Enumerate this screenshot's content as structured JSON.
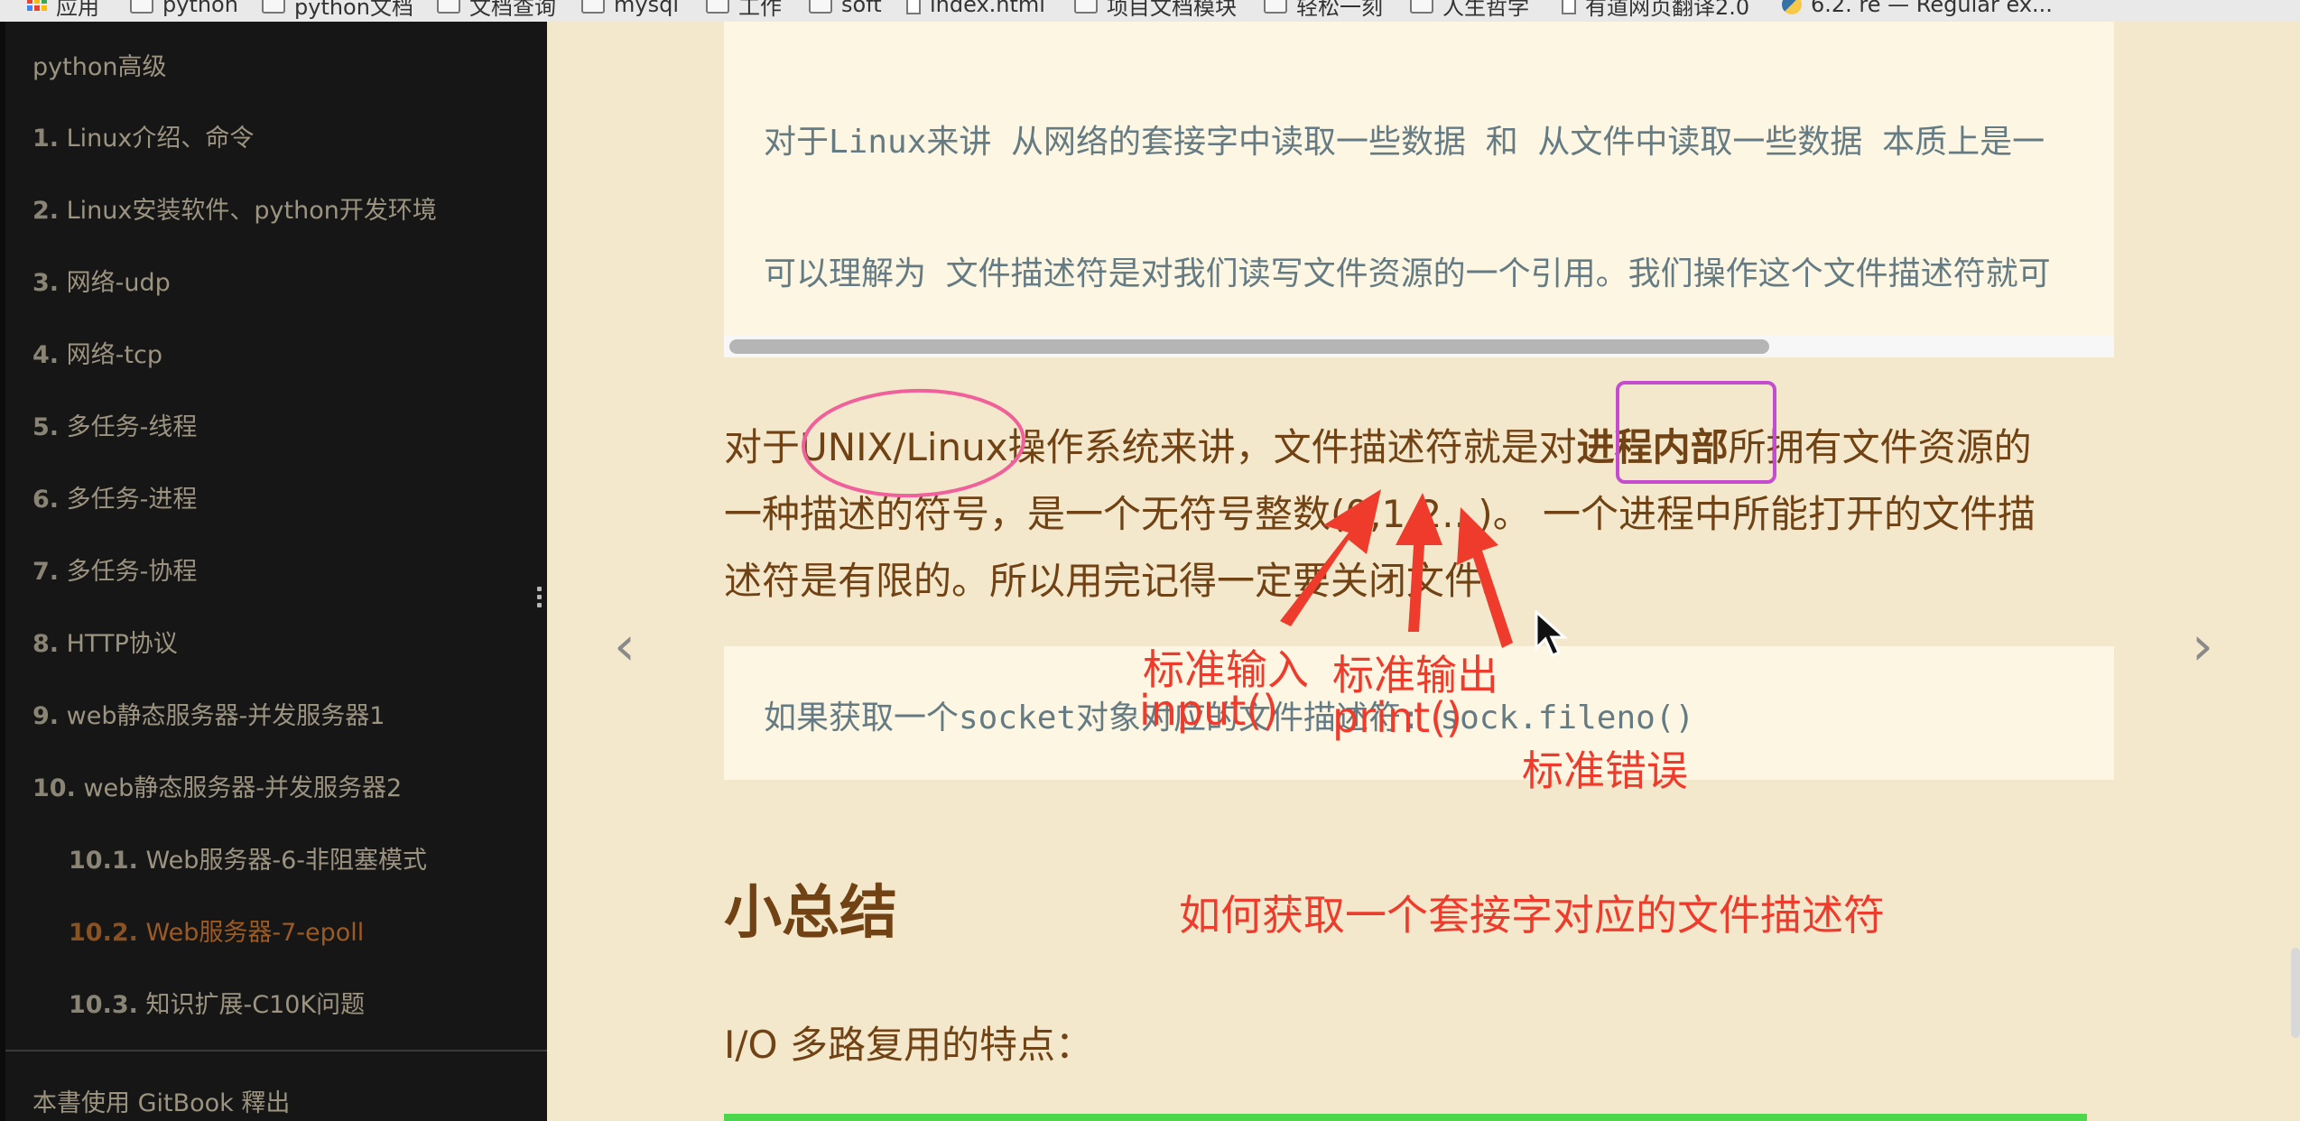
{
  "bookmarks": [
    {
      "label": "应用",
      "icon": "apps-grid-icon"
    },
    {
      "label": "python",
      "icon": "folder-icon"
    },
    {
      "label": "python文档",
      "icon": "folder-icon"
    },
    {
      "label": "文档查询",
      "icon": "folder-icon"
    },
    {
      "label": "mysql",
      "icon": "folder-icon"
    },
    {
      "label": "工作",
      "icon": "folder-icon"
    },
    {
      "label": "soft",
      "icon": "folder-icon"
    },
    {
      "label": "index.html",
      "icon": "page-icon"
    },
    {
      "label": "项目文档模块",
      "icon": "folder-icon"
    },
    {
      "label": "轻松一刻",
      "icon": "folder-icon"
    },
    {
      "label": "人生哲学",
      "icon": "folder-icon"
    },
    {
      "label": "有道网页翻译2.0",
      "icon": "page-icon"
    },
    {
      "label": "6.2. re — Regular ex...",
      "icon": "python-icon"
    }
  ],
  "sidebar": {
    "title": "python高级",
    "items": [
      {
        "num": "1.",
        "label": "Linux介绍、命令"
      },
      {
        "num": "2.",
        "label": "Linux安装软件、python开发环境"
      },
      {
        "num": "3.",
        "label": "网络-udp"
      },
      {
        "num": "4.",
        "label": "网络-tcp"
      },
      {
        "num": "5.",
        "label": "多任务-线程"
      },
      {
        "num": "6.",
        "label": "多任务-进程"
      },
      {
        "num": "7.",
        "label": "多任务-协程"
      },
      {
        "num": "8.",
        "label": "HTTP协议"
      },
      {
        "num": "9.",
        "label": "web静态服务器-并发服务器1"
      },
      {
        "num": "10.",
        "label": "web静态服务器-并发服务器2"
      },
      {
        "num": "10.1.",
        "label": "Web服务器-6-非阻塞模式"
      },
      {
        "num": "10.2.",
        "label": "Web服务器-7-epoll"
      },
      {
        "num": "10.3.",
        "label": "知识扩展-C10K问题"
      }
    ],
    "footer": "本書使用 GitBook 釋出"
  },
  "content": {
    "code1": [
      "对于Linux来讲 从网络的套接字中读取一些数据 和 从文件中读取一些数据  本质上是一",
      "可以理解为 文件描述符是对我们读写文件资源的一个引用。我们操作这个文件描述符就可"
    ],
    "para_lines": [
      "对于UNIX/Linux操作系统来讲，文件描述符就是对",
      "进程内部",
      "所拥有文件资源的",
      "一种描述的符号，是一个无符号整数(0,1,2...)。 一个进程中所能打开的文件描",
      "述符是有限的。所以用完记得一定要关闭文件。"
    ],
    "code2": "如果获取一个socket对象对应的文件描述符: sock.fileno()",
    "heading": "小总结",
    "subheading": "I/O 多路复用的特点："
  },
  "annotations": {
    "stdin": "标准输入",
    "stdin_fn": "input()",
    "stdout": "标准输出",
    "stdout_fn": "print()",
    "stderr": "标准错误",
    "note": "如何获取一个套接字对应的文件描述符",
    "color": "#ef3b2c"
  },
  "colors": {
    "sidebar_bg": "#161616",
    "content_bg": "#f4e8cc",
    "code_bg": "#fdf6e3",
    "text": "#704214",
    "active_item": "#9c5a24"
  }
}
